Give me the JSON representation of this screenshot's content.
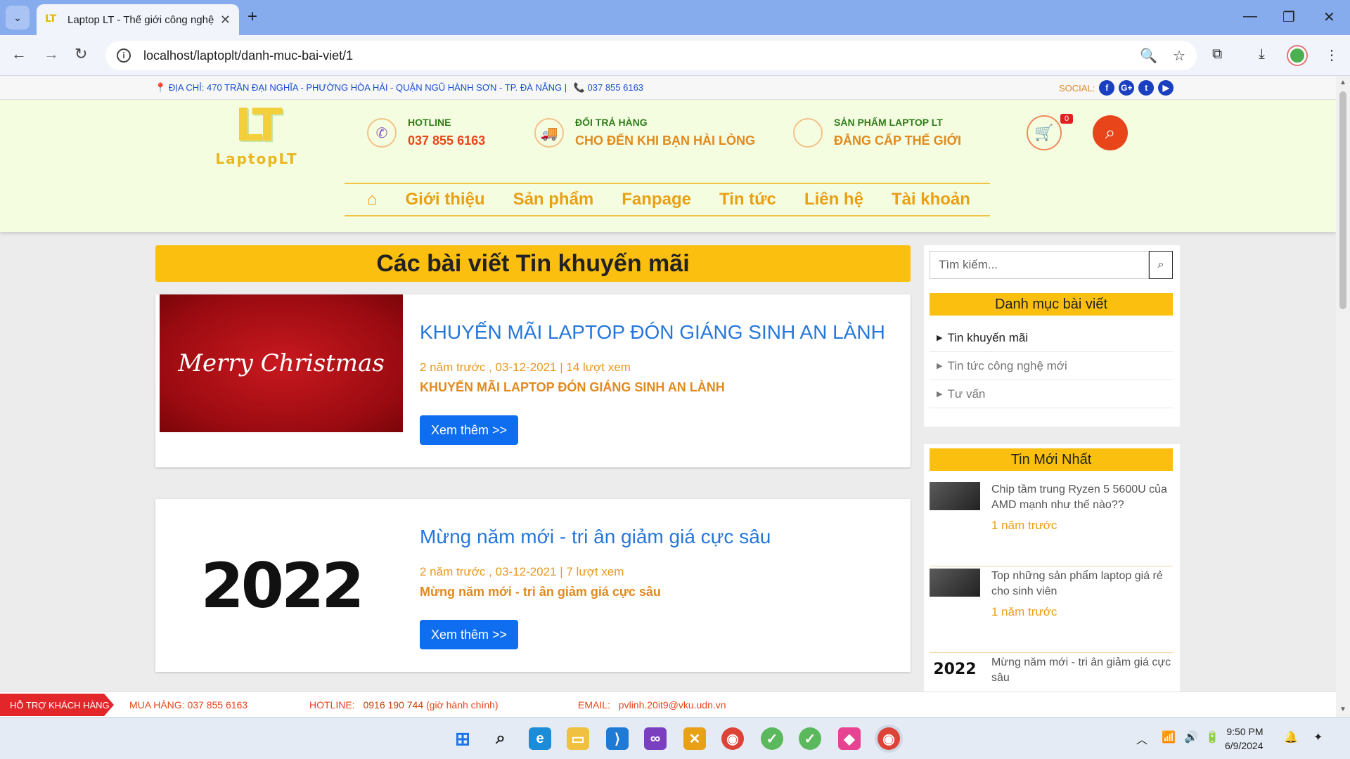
{
  "browser": {
    "tab_title": "Laptop LT - Thế giới công nghệ",
    "tab_favicon": "LT",
    "url": "localhost/laptoplt/danh-muc-bai-viet/1"
  },
  "topbar": {
    "address": "ĐỊA CHỈ: 470 TRẦN ĐẠI NGHĨA - PHƯỜNG HÒA HẢI - QUẬN NGŨ HÀNH SƠN - TP. ĐÀ NẴNG |",
    "phone": "037 855 6163",
    "social_label": "SOCIAL:",
    "social_icons": [
      "facebook-icon",
      "google-plus-icon",
      "twitter-icon",
      "youtube-icon"
    ]
  },
  "header": {
    "logo_mark": "LT",
    "logo_text": "LaptopLT",
    "boxes": [
      {
        "label": "HOTLINE",
        "value": "037 855 6163",
        "icon": "phone-icon"
      },
      {
        "label": "ĐỔI TRẢ HÀNG",
        "value": "CHO ĐẾN KHI BẠN HÀI LÒNG",
        "icon": "truck-icon"
      },
      {
        "label": "SẢN PHẨM LAPTOP LT",
        "value": "ĐẲNG CẤP THẾ GIỚI",
        "icon": "apple-icon"
      }
    ],
    "cart_count": "0"
  },
  "nav": {
    "items": [
      "Giới thiệu",
      "Sản phẩm",
      "Fanpage",
      "Tin tức",
      "Liên hệ",
      "Tài khoản"
    ]
  },
  "content": {
    "title": "Các bài viết Tin khuyến mãi",
    "posts": [
      {
        "image_text": "Merry Christmas",
        "title": "KHUYẾN MÃI LAPTOP ĐÓN GIÁNG SINH AN LÀNH",
        "meta": "2 năm trước , 03-12-2021 | 14 lượt xem",
        "desc": "KHUYẾN MÃI LAPTOP ĐÓN GIÁNG SINH AN LÀNH",
        "button": "Xem thêm >>"
      },
      {
        "image_text": "2022",
        "title": "Mừng năm mới - tri ân giảm giá cực sâu",
        "meta": "2 năm trước , 03-12-2021 | 7 lượt xem",
        "desc": "Mừng năm mới - tri ân giảm giá cực sâu",
        "button": "Xem thêm >>"
      }
    ]
  },
  "sidebar": {
    "search_placeholder": "Tìm kiếm...",
    "categories_title": "Danh mục bài viết",
    "categories": [
      "Tin khuyến mãi",
      "Tin tức công nghệ mới",
      "Tư vấn"
    ],
    "latest_title": "Tin Mới Nhất",
    "latest": [
      {
        "title": "Chip tầm trung Ryzen 5 5600U của AMD mạnh như thế nào??",
        "time": "1 năm trước"
      },
      {
        "title": "Top những sản phẩm laptop giá rẻ cho sinh viên",
        "time": "1 năm trước"
      },
      {
        "title": "Mừng năm mới - tri ân giảm giá cực sâu",
        "thumb_text": "2022",
        "time": ""
      }
    ]
  },
  "footer": {
    "support": "HỖ TRỢ KHÁCH HÀNG",
    "buy_label": "MUA HÀNG: 037 855 6163",
    "hotline_label": "HOTLINE:",
    "hotline_value": "0916 190 744",
    "hotline_note": "(giờ hành chính)",
    "email_label": "EMAIL:",
    "email_value": "pvlinh.20it9@vku.udn.vn"
  },
  "taskbar": {
    "time": "9:50 PM",
    "date": "6/9/2024"
  }
}
